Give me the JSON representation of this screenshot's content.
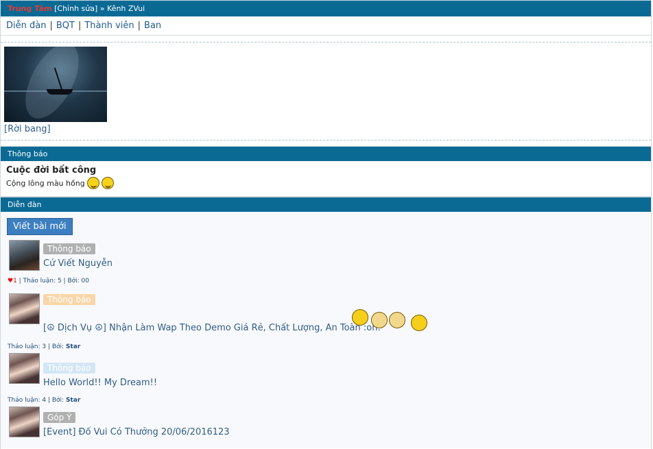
{
  "header": {
    "site": "Trung Tâm",
    "edit": "[Chỉnh sửa]",
    "crumb": "» Kênh ZVui"
  },
  "nav": {
    "items": [
      "Diễn đàn",
      "BQT",
      "Thành viên",
      "Ban"
    ]
  },
  "clan": {
    "leave": "[Rời bang]"
  },
  "notice": {
    "header": "Thông báo",
    "title": "Cuộc đời bất công",
    "text": "Cộng lông màu hồng"
  },
  "forum": {
    "header": "Diễn đàn",
    "new_post": "Viết bài mới",
    "topics": [
      {
        "tag": "Thông báo",
        "title": "Cứ Viết Nguyễn",
        "heart": "♥1",
        "meta": "| Thảo luận: 5 | Bởi: 00",
        "by": ""
      },
      {
        "tag": "Thông báo",
        "title": "[☮ Dịch Vụ ☮] Nhận Làm Wap Theo Demo Giá Rẻ, Chất Lượng, An Toàn :oh:",
        "meta": "Thảo luận: 3 | Bởi:",
        "by": "Star"
      },
      {
        "tag": "Thông báo",
        "title": "Hello World!! My Dream!!",
        "meta": "Thảo luận: 4 | Bởi:",
        "by": "Star"
      },
      {
        "tag": "Góp Ý",
        "title": "[Event] Đố Vui Có Thưởng 20/06/2016123"
      }
    ]
  },
  "colors": {
    "bar": "#0b6a94",
    "link": "#2f5d86",
    "site": "#e53935",
    "button": "#3b7fc0"
  }
}
